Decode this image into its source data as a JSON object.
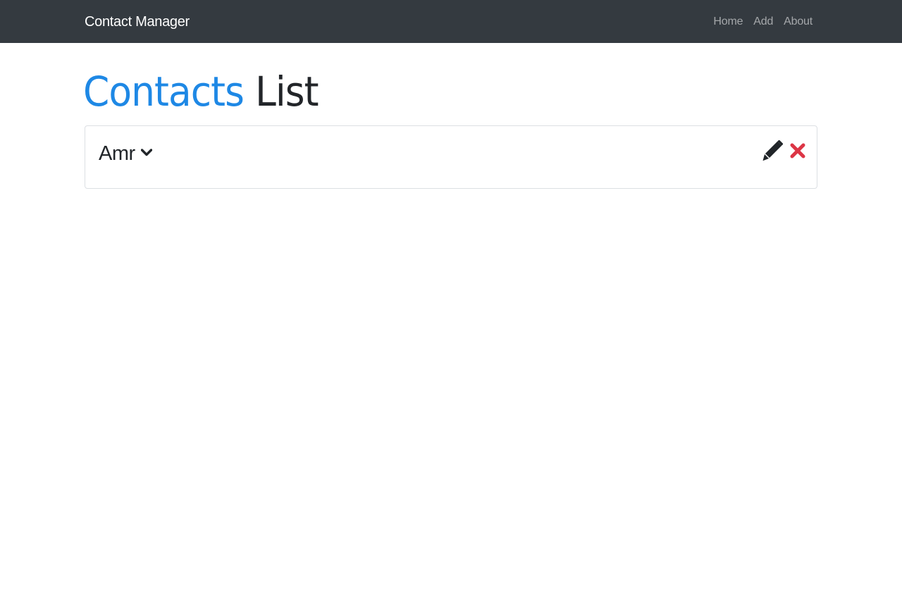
{
  "navbar": {
    "brand": "Contact Manager",
    "links": [
      {
        "label": "Home"
      },
      {
        "label": "Add"
      },
      {
        "label": "About"
      }
    ],
    "background": "#343a40"
  },
  "page": {
    "title_accent": "Contacts",
    "title_rest": "List",
    "accent_color": "#1e88e5"
  },
  "contacts": [
    {
      "name": "Amr",
      "expand_icon": "chevron-down-icon",
      "edit_icon": "pencil-icon",
      "delete_icon": "times-icon",
      "delete_color": "#dc3545"
    }
  ]
}
